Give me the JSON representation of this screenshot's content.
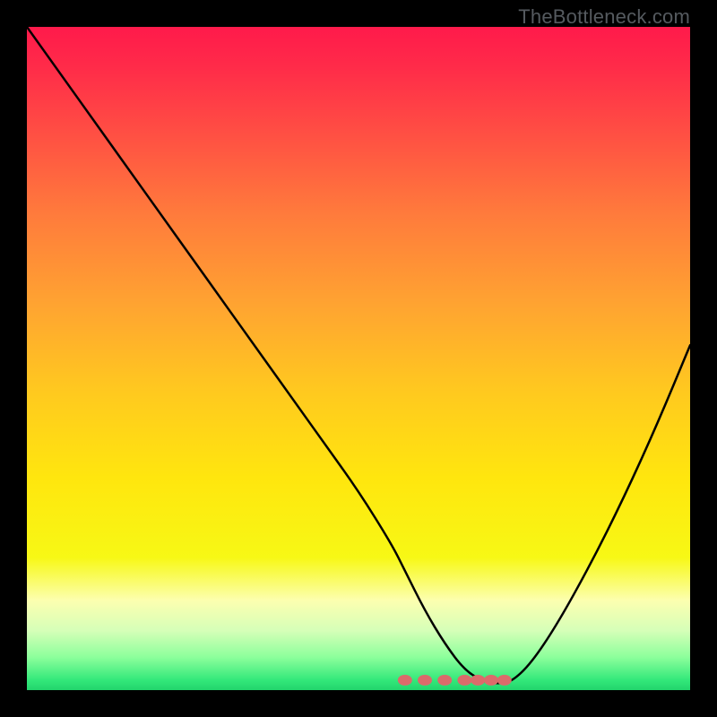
{
  "watermark": "TheBottleneck.com",
  "colors": {
    "frame": "#000000",
    "curve_stroke": "#000000",
    "marker_fill": "#db6b6b",
    "gradient_stops": [
      {
        "offset": 0.0,
        "color": "#ff1a4b"
      },
      {
        "offset": 0.06,
        "color": "#ff2b49"
      },
      {
        "offset": 0.15,
        "color": "#ff4b44"
      },
      {
        "offset": 0.28,
        "color": "#ff7a3c"
      },
      {
        "offset": 0.42,
        "color": "#ffa431"
      },
      {
        "offset": 0.55,
        "color": "#ffc91f"
      },
      {
        "offset": 0.68,
        "color": "#ffe60e"
      },
      {
        "offset": 0.8,
        "color": "#f7f815"
      },
      {
        "offset": 0.865,
        "color": "#fcffb0"
      },
      {
        "offset": 0.91,
        "color": "#d6ffb8"
      },
      {
        "offset": 0.95,
        "color": "#8dff9c"
      },
      {
        "offset": 0.985,
        "color": "#33e87a"
      },
      {
        "offset": 1.0,
        "color": "#22d46c"
      }
    ]
  },
  "chart_data": {
    "type": "line",
    "title": "",
    "xlabel": "",
    "ylabel": "",
    "xlim": [
      0,
      100
    ],
    "ylim": [
      0,
      100
    ],
    "grid": false,
    "series": [
      {
        "name": "bottleneck-curve",
        "x": [
          0,
          5,
          10,
          15,
          20,
          25,
          30,
          35,
          40,
          45,
          50,
          55,
          57,
          60,
          63,
          66,
          69,
          71,
          73,
          76,
          80,
          85,
          90,
          95,
          100
        ],
        "y": [
          100,
          93,
          86,
          79,
          72,
          65,
          58,
          51,
          44,
          37,
          30,
          22,
          18,
          12,
          7,
          3,
          1.2,
          1.0,
          1.2,
          4,
          10,
          19,
          29,
          40,
          52
        ]
      }
    ],
    "annotations": {
      "sweet_spot_markers_x": [
        57,
        60,
        63,
        66,
        68,
        70,
        72
      ],
      "sweet_spot_y": 1.5
    }
  }
}
